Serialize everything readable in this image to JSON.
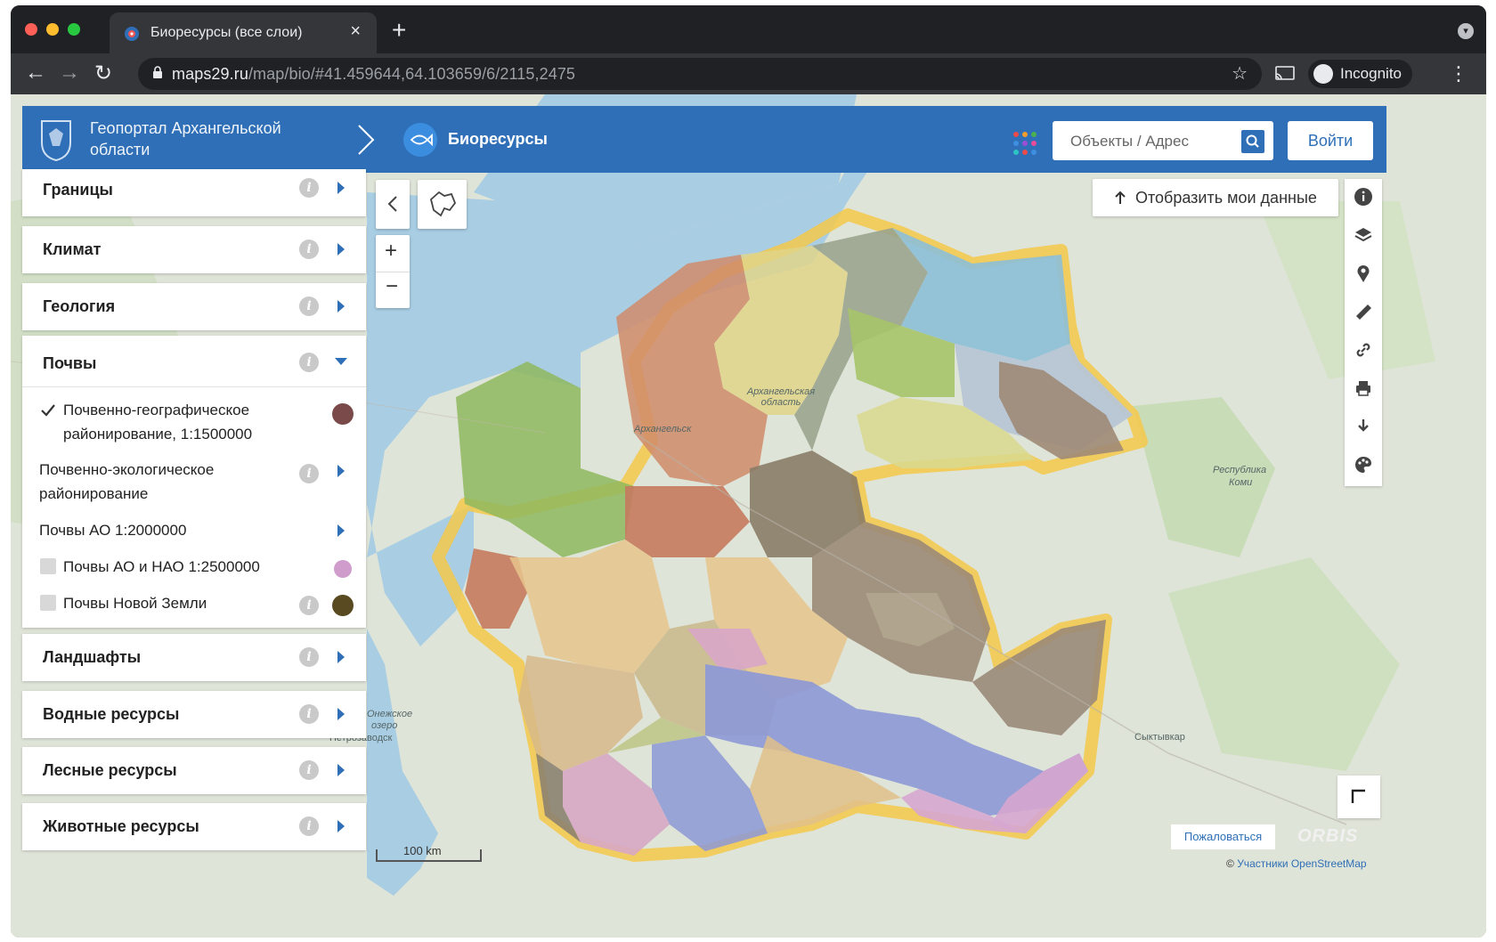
{
  "browser": {
    "tab_title": "Биоресурсы (все слои)",
    "tab_close": "×",
    "new_tab": "+",
    "url_host": "maps29.ru",
    "url_path": "/map/bio/#41.459644,64.103659/6/2115,2475",
    "incognito_label": "Incognito",
    "nav_back": "←",
    "nav_forward": "→",
    "nav_reload": "↻",
    "star": "☆",
    "menu": "⋮"
  },
  "header": {
    "portal_title": "Геопортал Архангельской области",
    "section_title": "Биоресурсы",
    "search_placeholder": "Объекты / Адрес",
    "login_label": "Войти",
    "brand_color": "#2f6fb7"
  },
  "layers_panel": {
    "groups_top": [
      {
        "label": "Границы"
      },
      {
        "label": "Климат"
      },
      {
        "label": "Геология"
      }
    ],
    "expanded_group": {
      "label": "Почвы",
      "items": [
        {
          "label_line1": "Почвенно-географическое",
          "label_line2": "районирование, 1:1500000",
          "checked": true,
          "swatch": "#7a4a4a"
        },
        {
          "label_line1": "Почвенно-экологическое",
          "label_line2": "районирование",
          "type": "group"
        },
        {
          "label": "Почвы АО 1:2000000",
          "type": "group"
        },
        {
          "label": "Почвы АО и НАО 1:2500000",
          "checked": false,
          "swatch": "#cf9ccc"
        },
        {
          "label": "Почвы Новой Земли",
          "checked": false,
          "swatch": "#5a4a22"
        }
      ]
    },
    "groups_bottom": [
      {
        "label": "Ландшафты"
      },
      {
        "label": "Водные ресурсы"
      },
      {
        "label": "Лесные ресурсы"
      },
      {
        "label": "Животные ресурсы"
      }
    ]
  },
  "map": {
    "show_my_data": "Отобразить мои данные",
    "zoom_in": "+",
    "zoom_out": "−",
    "collapse": "‹",
    "scale_label": "100 km",
    "report_label": "Пожаловаться",
    "orbis_logo": "ORBIS",
    "attribution_prefix": "©",
    "attribution_link": "Участники OpenStreetMap",
    "labels": {
      "arkhangelsk": "Архангельск",
      "region": "Архангельская область",
      "komi_1": "Республика",
      "komi_2": "Коми",
      "syktyvkar": "Сыктывкар",
      "onega_1": "Онежское",
      "onega_2": "озеро",
      "petrozavodsk": "Петрозаводск"
    },
    "right_tools": [
      "info-icon",
      "layers-icon",
      "pin-icon",
      "ruler-icon",
      "link-icon",
      "print-icon",
      "download-icon",
      "palette-icon"
    ]
  }
}
